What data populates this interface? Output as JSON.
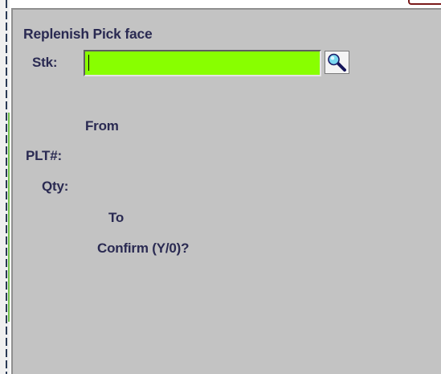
{
  "window": {
    "title": "Replenish Pick face"
  },
  "form": {
    "stk_label": "Stk:",
    "stk_value": "",
    "from_label": "From",
    "plt_label": "PLT#:",
    "qty_label": "Qty:",
    "to_label": "To",
    "confirm_label": "Confirm (Y/0)?"
  },
  "icons": {
    "lookup": "magnifier-icon"
  },
  "colors": {
    "panel_background": "#c3c3c3",
    "active_field": "#88ff00",
    "label_text": "#2a2a52"
  }
}
